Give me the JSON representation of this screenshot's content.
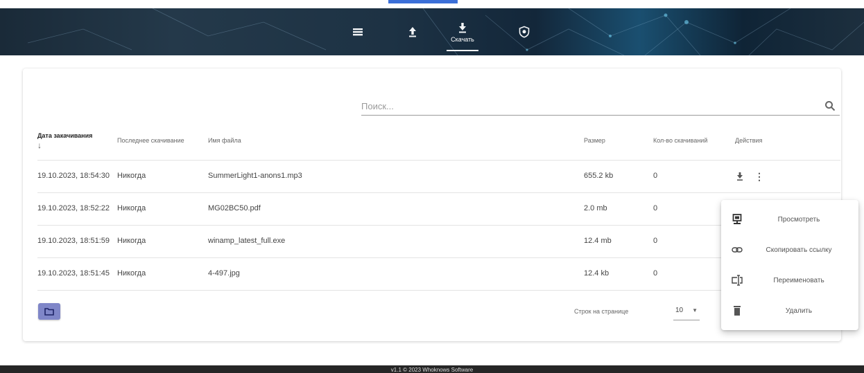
{
  "header": {
    "nav": [
      {
        "name": "list",
        "label": "",
        "icon": "list-icon"
      },
      {
        "name": "upload",
        "label": "",
        "icon": "upload-icon"
      },
      {
        "name": "download",
        "label": "Скачать",
        "icon": "download-icon",
        "active": true
      },
      {
        "name": "security",
        "label": "",
        "icon": "shield-icon"
      }
    ]
  },
  "search": {
    "placeholder": "Поиск..."
  },
  "table": {
    "columns": {
      "date": "Дата закачивания",
      "last": "Последнее скачивание",
      "name": "Имя файла",
      "size": "Размер",
      "count": "Кол-во скачиваний",
      "actions": "Действия"
    },
    "sort_indicator": "↓",
    "rows": [
      {
        "date": "19.10.2023, 18:54:30",
        "last": "Никогда",
        "name": "SummerLight1-anons1.mp3",
        "size": "655.2 kb",
        "count": "0"
      },
      {
        "date": "19.10.2023, 18:52:22",
        "last": "Никогда",
        "name": "MG02BC50.pdf",
        "size": "2.0 mb",
        "count": "0"
      },
      {
        "date": "19.10.2023, 18:51:59",
        "last": "Никогда",
        "name": "winamp_latest_full.exe",
        "size": "12.4 mb",
        "count": "0"
      },
      {
        "date": "19.10.2023, 18:51:45",
        "last": "Никогда",
        "name": "4-497.jpg",
        "size": "12.4 kb",
        "count": "0"
      }
    ]
  },
  "pagination": {
    "rows_per_page_label": "Строк на странице",
    "rows_per_page": "10"
  },
  "context_menu": {
    "items": [
      {
        "label": "Просмотреть",
        "icon": "preview-icon"
      },
      {
        "label": "Скопировать ссылку",
        "icon": "link-icon"
      },
      {
        "label": "Переименовать",
        "icon": "rename-icon"
      },
      {
        "label": "Удалить",
        "icon": "trash-icon"
      }
    ]
  },
  "footer": {
    "text": "v1.1 © 2023 Whoknows Software"
  },
  "colors": {
    "accent": "#7f86c8",
    "header_bg": "#1d3244",
    "footer_bg": "#262626"
  }
}
